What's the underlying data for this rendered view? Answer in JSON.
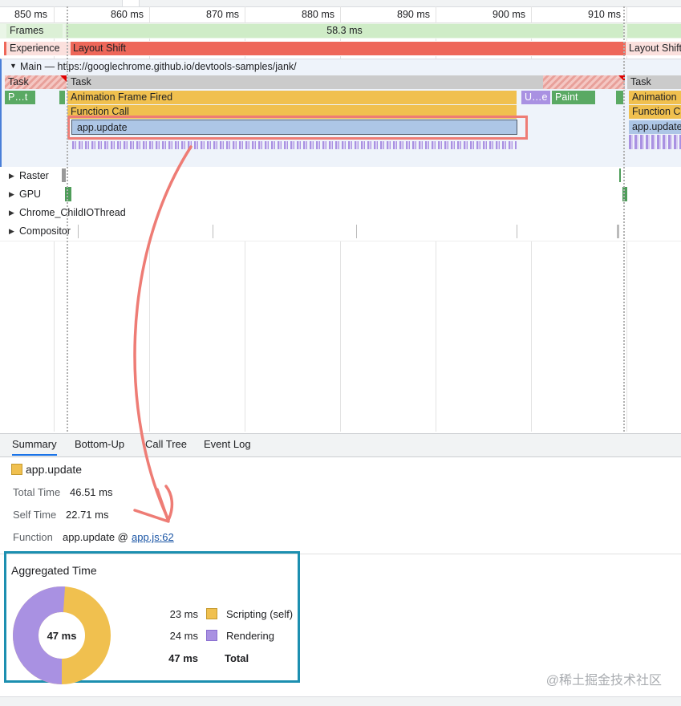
{
  "ruler": {
    "ticks": [
      "850 ms",
      "860 ms",
      "870 ms",
      "880 ms",
      "890 ms",
      "900 ms",
      "910 ms"
    ]
  },
  "frames": {
    "label": "Frames",
    "duration": "58.3 ms"
  },
  "experience": {
    "label": "Experience",
    "layout_shift_1": "Layout Shift",
    "layout_shift_2": "Layout Shift"
  },
  "main": {
    "header": "Main — https://googlechrome.github.io/devtools-samples/jank/",
    "task_left": "Task",
    "task_main": "Task",
    "task_right": "Task",
    "paint_small": "P…t",
    "animation_frame": "Animation Frame Fired",
    "function_call": "Function Call",
    "app_update": "app.update",
    "update_small": "U…e",
    "paint": "Paint",
    "animation_right": "Animation",
    "function_right": "Function C",
    "app_update_right": "app.update"
  },
  "threads": [
    "Raster",
    "GPU",
    "Chrome_ChildIOThread",
    "Compositor"
  ],
  "tabs": [
    "Summary",
    "Bottom-Up",
    "Call Tree",
    "Event Log"
  ],
  "summary": {
    "title": "app.update",
    "total_time_label": "Total Time",
    "total_time_value": "46.51 ms",
    "self_time_label": "Self Time",
    "self_time_value": "22.71 ms",
    "function_label": "Function",
    "function_value": "app.update @",
    "function_link": "app.js:62"
  },
  "aggregated": {
    "title": "Aggregated Time",
    "center": "47 ms",
    "rows": [
      {
        "value": "23 ms",
        "name": "Scripting (self)",
        "color": "#f0c04f"
      },
      {
        "value": "24 ms",
        "name": "Rendering",
        "color": "#a991e2"
      }
    ],
    "total_value": "47 ms",
    "total_name": "Total"
  },
  "colors": {
    "frames": "#cfecc7",
    "layout_shift": "#ee6759",
    "task": "#cbcbcb",
    "scripting": "#f0c04f",
    "app_update": "#adc6e6",
    "rendering": "#a991e2",
    "painting": "#5aa963",
    "highlight_red": "#ee7c75",
    "highlight_blue": "#1c8fb0"
  },
  "watermark": "@稀土掘金技术社区"
}
